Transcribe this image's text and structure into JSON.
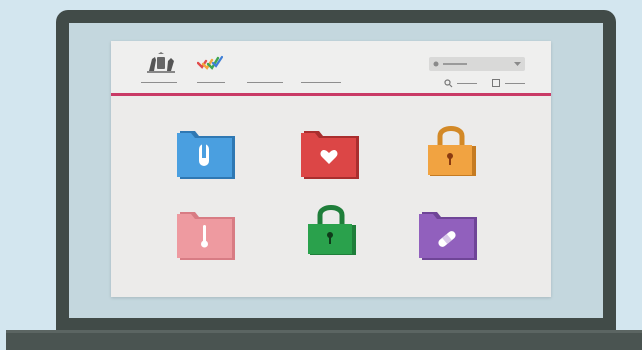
{
  "colors": {
    "background": "#d3e6ef",
    "laptop": "#414b48",
    "window": "#ecebea",
    "header_accent": "#c93a66"
  },
  "header": {
    "logos": [
      "coat-of-arms-icon",
      "colorful-checkmark-logo"
    ],
    "nav_link_count": 3,
    "search": {
      "icon": "dot-icon",
      "dropdown_icon": "chevron-down-icon"
    },
    "utilities": [
      "search-icon",
      "square-icon"
    ]
  },
  "tiles": [
    {
      "kind": "folder",
      "color": "#4a9fe0",
      "icon": "test-tube-icon"
    },
    {
      "kind": "folder",
      "color": "#dc4646",
      "icon": "heart-icon"
    },
    {
      "kind": "lock",
      "color": "#f1a341",
      "icon": "keyhole-icon"
    },
    {
      "kind": "folder",
      "color": "#ee9aa0",
      "icon": "thermometer-icon"
    },
    {
      "kind": "lock",
      "color": "#2aa14c",
      "icon": "keyhole-icon"
    },
    {
      "kind": "folder",
      "color": "#9160bd",
      "icon": "bandage-icon"
    }
  ]
}
